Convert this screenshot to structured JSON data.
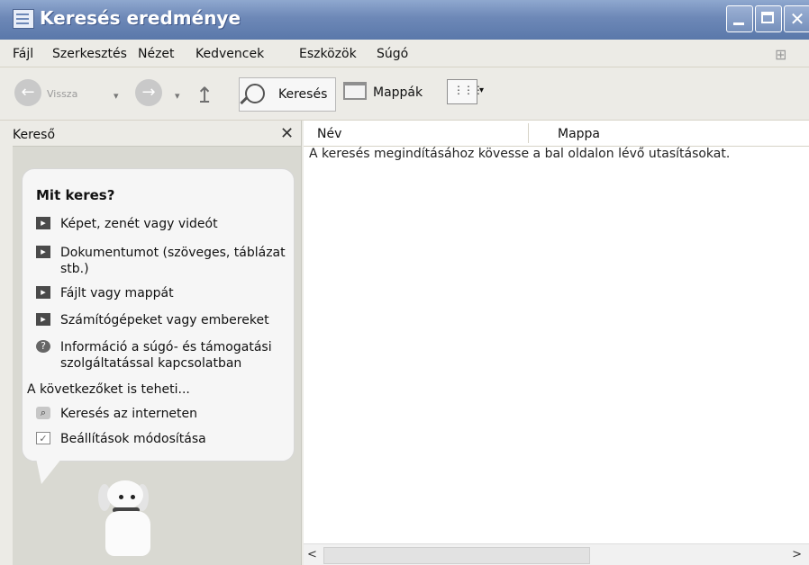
{
  "window": {
    "title": "Keresés eredménye",
    "buttons": {
      "minimize": "",
      "maximize": "",
      "close": "✕"
    }
  },
  "menu": [
    "Fájl",
    "Szerkesztés",
    "Nézet",
    "Kedvencek",
    "Eszközök",
    "Súgó"
  ],
  "toolbar": {
    "back": "Vissza",
    "search": "Keresés",
    "folders": "Mappák",
    "views_arrow": "▾"
  },
  "left_pane": {
    "title": "Kereső",
    "close": "✕",
    "question": "Mit keres?",
    "options": [
      {
        "label": "Képet, zenét vagy videót",
        "icon": "arrow-right-icon"
      },
      {
        "label": "Dokumentumot (szöveges, táblázat stb.)",
        "icon": "arrow-right-icon"
      },
      {
        "label": "Fájlt vagy mappát",
        "icon": "arrow-right-icon"
      },
      {
        "label": "Számítógépeket vagy embereket",
        "icon": "arrow-right-icon"
      },
      {
        "label": "Információ a súgó- és támogatási szolgáltatással kapcsolatban",
        "icon": "help-icon"
      }
    ],
    "more_heading": "A következőket is teheti...",
    "more_options": [
      {
        "label": "Keresés az interneten",
        "icon": "globe-search-icon"
      },
      {
        "label": "Beállítások módosítása",
        "icon": "settings-icon"
      }
    ]
  },
  "content": {
    "columns": [
      "Név",
      "Mappa"
    ],
    "message": "A keresés megindításához kövesse a bal oldalon lévő utasításokat."
  },
  "scroll": {
    "left": "<",
    "right": ">"
  }
}
